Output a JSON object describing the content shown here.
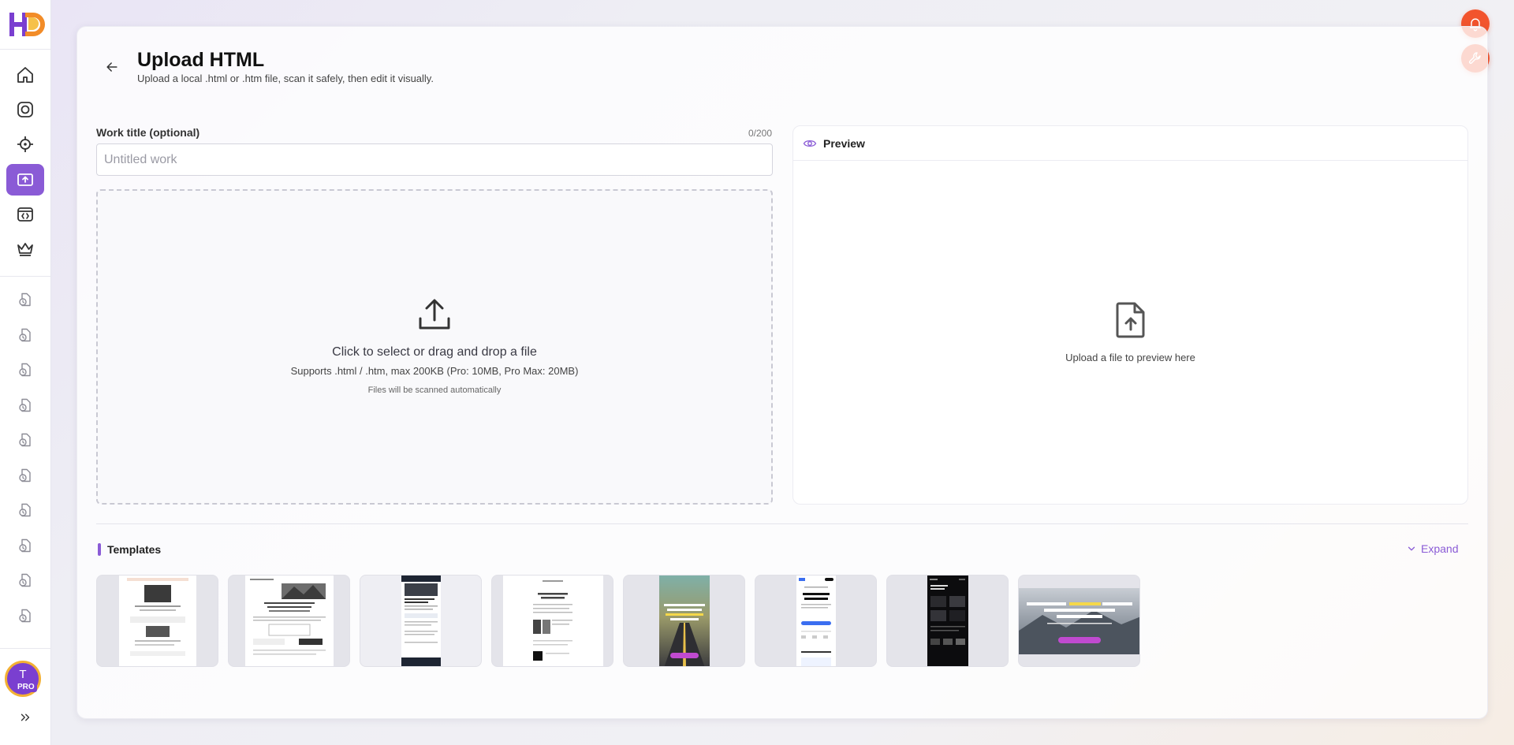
{
  "colors": {
    "accent": "#8a5bd6",
    "orange": "#f2542d",
    "avatar_bg": "#7a3fd0",
    "avatar_ring": "#f3b033"
  },
  "sidebar": {
    "logo": "HD",
    "nav_items": [
      {
        "icon": "home-icon"
      },
      {
        "icon": "camera-icon"
      },
      {
        "icon": "target-icon"
      },
      {
        "icon": "upload-icon",
        "active": true
      },
      {
        "icon": "code-window-icon"
      },
      {
        "icon": "crown-icon"
      }
    ],
    "history_items": [
      {
        "icon": "history-file-icon"
      },
      {
        "icon": "history-file-icon"
      },
      {
        "icon": "history-file-icon"
      },
      {
        "icon": "history-file-icon"
      },
      {
        "icon": "history-file-icon"
      },
      {
        "icon": "history-file-icon"
      },
      {
        "icon": "history-file-icon"
      },
      {
        "icon": "history-file-icon"
      },
      {
        "icon": "history-file-icon"
      },
      {
        "icon": "history-file-icon"
      }
    ],
    "avatar_letter": "T",
    "avatar_badge": "PRO"
  },
  "header": {
    "title": "Upload HTML",
    "subtitle": "Upload a local .html or .htm file, scan it safely, then edit it visually."
  },
  "form": {
    "title_label": "Work title (optional)",
    "char_count": "0/200",
    "title_placeholder": "Untitled work",
    "title_value": ""
  },
  "dropzone": {
    "title": "Click to select or drag and drop a file",
    "supports": "Supports .html / .htm, max 200KB (Pro: 10MB, Pro Max: 20MB)",
    "note": "Files will be scanned automatically"
  },
  "preview": {
    "label": "Preview",
    "empty_text": "Upload a file to preview here"
  },
  "templates": {
    "label": "Templates",
    "expand_label": "Expand",
    "items": [
      {
        "style": "article-light"
      },
      {
        "style": "article-landscape"
      },
      {
        "style": "article-dark-header"
      },
      {
        "style": "minimal-text"
      },
      {
        "style": "freeform-road",
        "heading": "FREEFORM DRAG AND DROP WITH TRUE WYSIWYG EDITING"
      },
      {
        "style": "creative-copilot",
        "heading": "Creative Copilot.",
        "footer": "Power for"
      },
      {
        "style": "dark-gallery"
      },
      {
        "style": "freeform-wide",
        "heading": "FREEFORM DRAG AND DROP WITH TRUE WYSIWYG EDITING"
      }
    ]
  }
}
